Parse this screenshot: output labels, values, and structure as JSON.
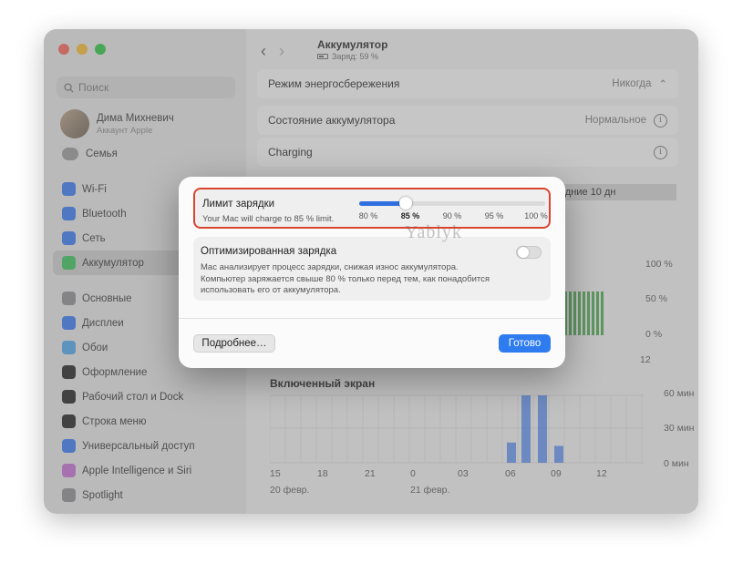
{
  "sidebar": {
    "search_placeholder": "Поиск",
    "user": {
      "name": "Дима Михневич",
      "subtitle": "Аккаунт Apple"
    },
    "family": "Семья",
    "group1": [
      {
        "label": "Wi-Fi",
        "icon": "wifi-icon",
        "color": "#3478f6"
      },
      {
        "label": "Bluetooth",
        "icon": "bluetooth-icon",
        "color": "#3478f6"
      },
      {
        "label": "Сеть",
        "icon": "globe-icon",
        "color": "#3478f6"
      },
      {
        "label": "Аккумулятор",
        "icon": "battery-icon",
        "color": "#34c759",
        "active": true
      }
    ],
    "group2": [
      {
        "label": "Основные",
        "icon": "gear-icon",
        "color": "#8e8e93"
      },
      {
        "label": "Дисплеи",
        "icon": "display-icon",
        "color": "#3478f6"
      },
      {
        "label": "Обои",
        "icon": "wallpaper-icon",
        "color": "#4aa8f0"
      },
      {
        "label": "Оформление",
        "icon": "appearance-icon",
        "color": "#1c1c1e"
      },
      {
        "label": "Рабочий стол и Dock",
        "icon": "dock-icon",
        "color": "#1c1c1e"
      },
      {
        "label": "Строка меню",
        "icon": "menubar-icon",
        "color": "#1c1c1e"
      },
      {
        "label": "Универсальный доступ",
        "icon": "accessibility-icon",
        "color": "#3478f6"
      },
      {
        "label": "Apple Intelligence и Siri",
        "icon": "siri-icon",
        "color": "#c86dd7"
      },
      {
        "label": "Spotlight",
        "icon": "spotlight-icon",
        "color": "#8e8e93"
      }
    ]
  },
  "header": {
    "title": "Аккумулятор",
    "subtitle": "Заряд: 59 %"
  },
  "settings": {
    "power_mode": {
      "label": "Режим энергосбережения",
      "value": "Никогда"
    },
    "battery_health": {
      "label": "Состояние аккумулятора",
      "value": "Нормальное"
    },
    "charging": {
      "label": "Charging"
    },
    "period": "едние 10 дн"
  },
  "usage_chart": {
    "y_labels": [
      "100 %",
      "50 %",
      "0 %"
    ],
    "x_label_partial": "12"
  },
  "screen_chart": {
    "title": "Включенный экран",
    "y_labels": [
      "60 мин",
      "30 мин",
      "0 мин"
    ],
    "x_labels": [
      "15",
      "18",
      "21",
      "0",
      "03",
      "06",
      "09",
      "12"
    ],
    "date_labels": [
      "20 февр.",
      "21 февр."
    ]
  },
  "dialog": {
    "limit": {
      "title": "Лимит зарядки",
      "subtitle": "Your Mac will charge to 85 % limit.",
      "ticks": [
        "80 %",
        "85 %",
        "90 %",
        "95 %",
        "100 %"
      ],
      "selected_index": 1,
      "value_fraction": 0.25
    },
    "optimized": {
      "title": "Оптимизированная зарядка",
      "description": "Mac анализирует процесс зарядки, снижая износ аккумулятора. Компьютер заряжается свыше 80 % только перед тем, как понадобится использовать его от аккумулятора.",
      "enabled": false
    },
    "more_button": "Подробнее…",
    "done_button": "Готово"
  },
  "watermark": "Yablyk",
  "colors": {
    "accent": "#2f7cf0",
    "highlight_border": "#d9442f",
    "usage_bar": "#4caf50",
    "screen_bar": "#3478f6"
  }
}
